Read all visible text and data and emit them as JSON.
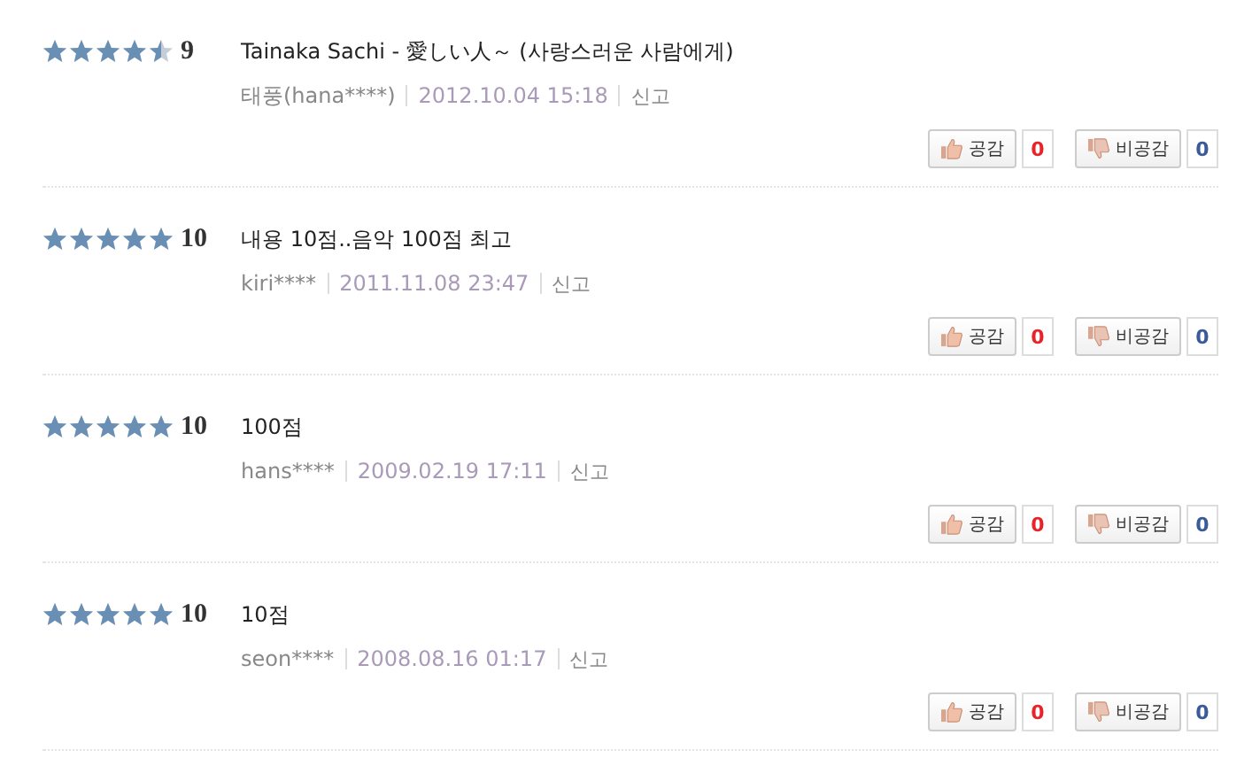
{
  "reviews": [
    {
      "stars": 4.5,
      "score": "9",
      "text": "Tainaka Sachi - 愛しい人～ (사랑스러운 사람에게)",
      "author": "태풍(hana****)",
      "date": "2012.10.04 15:18",
      "report": "신고",
      "agree": {
        "label": "공감",
        "count": "0"
      },
      "disagree": {
        "label": "비공감",
        "count": "0"
      }
    },
    {
      "stars": 5,
      "score": "10",
      "text": "내용 10점..음악 100점 최고",
      "author": "kiri****",
      "date": "2011.11.08 23:47",
      "report": "신고",
      "agree": {
        "label": "공감",
        "count": "0"
      },
      "disagree": {
        "label": "비공감",
        "count": "0"
      }
    },
    {
      "stars": 5,
      "score": "10",
      "text": "100점",
      "author": "hans****",
      "date": "2009.02.19 17:11",
      "report": "신고",
      "agree": {
        "label": "공감",
        "count": "0"
      },
      "disagree": {
        "label": "비공감",
        "count": "0"
      }
    },
    {
      "stars": 5,
      "score": "10",
      "text": "10점",
      "author": "seon****",
      "date": "2008.08.16 01:17",
      "report": "신고",
      "agree": {
        "label": "공감",
        "count": "0"
      },
      "disagree": {
        "label": "비공감",
        "count": "0"
      }
    }
  ]
}
